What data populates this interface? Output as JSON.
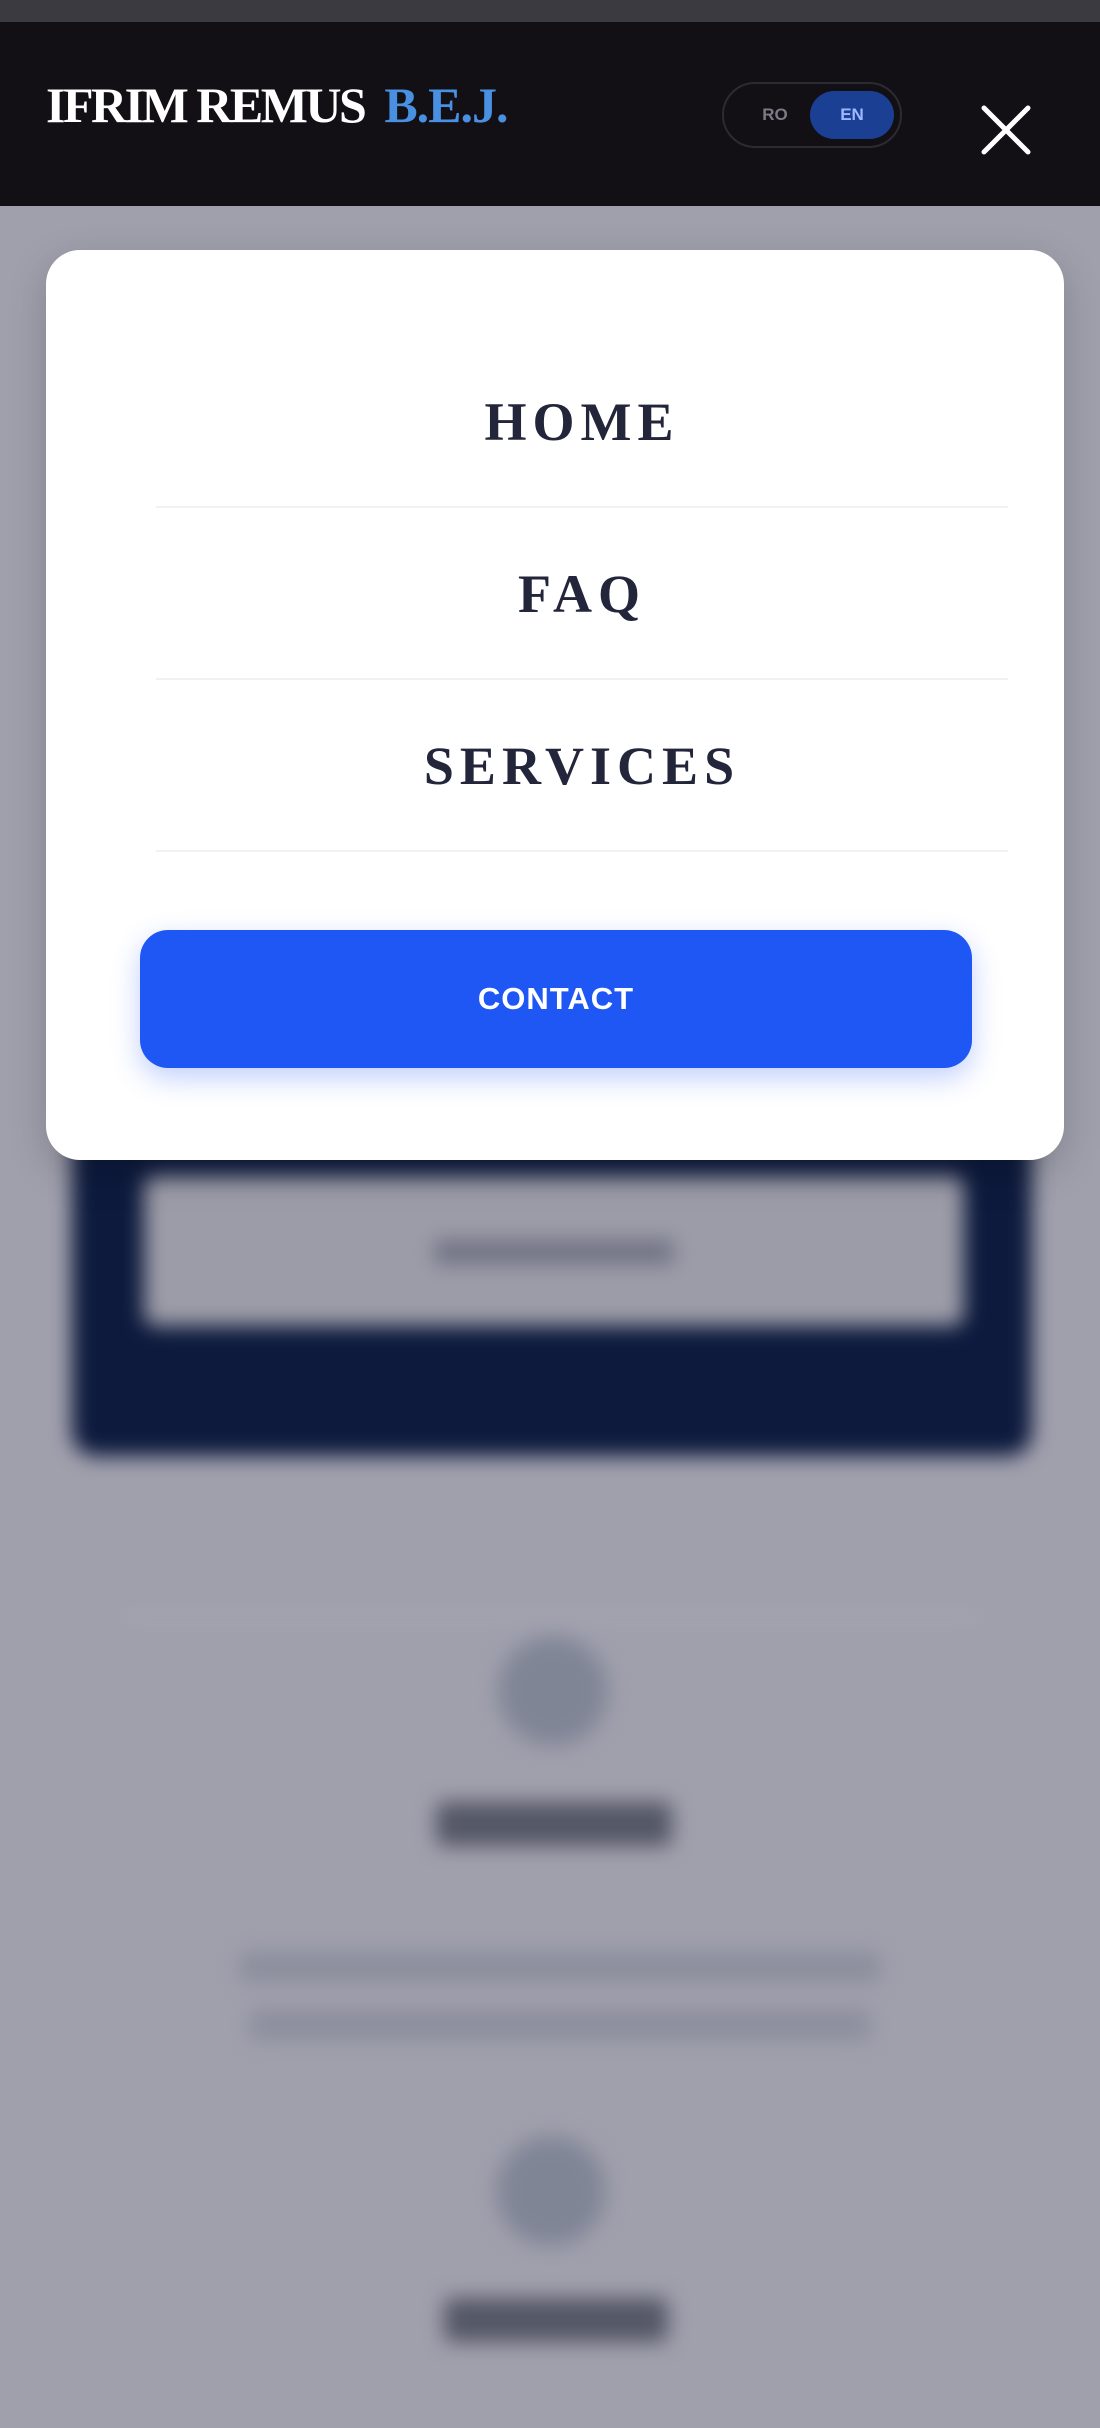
{
  "header": {
    "logo_name": "IFRIM REMUS",
    "logo_suffix": "B.E.J.",
    "lang_ro": "RO",
    "lang_en": "EN",
    "close_icon": "close-icon"
  },
  "menu": {
    "items": [
      {
        "label": "HOME"
      },
      {
        "label": "FAQ"
      },
      {
        "label": "SERVICES"
      }
    ],
    "contact_label": "CONTACT"
  },
  "colors": {
    "accent": "#1f57f5",
    "logo_accent": "#4a90e2",
    "header_bg": "#121015",
    "overlay": "#a0a0ad"
  }
}
